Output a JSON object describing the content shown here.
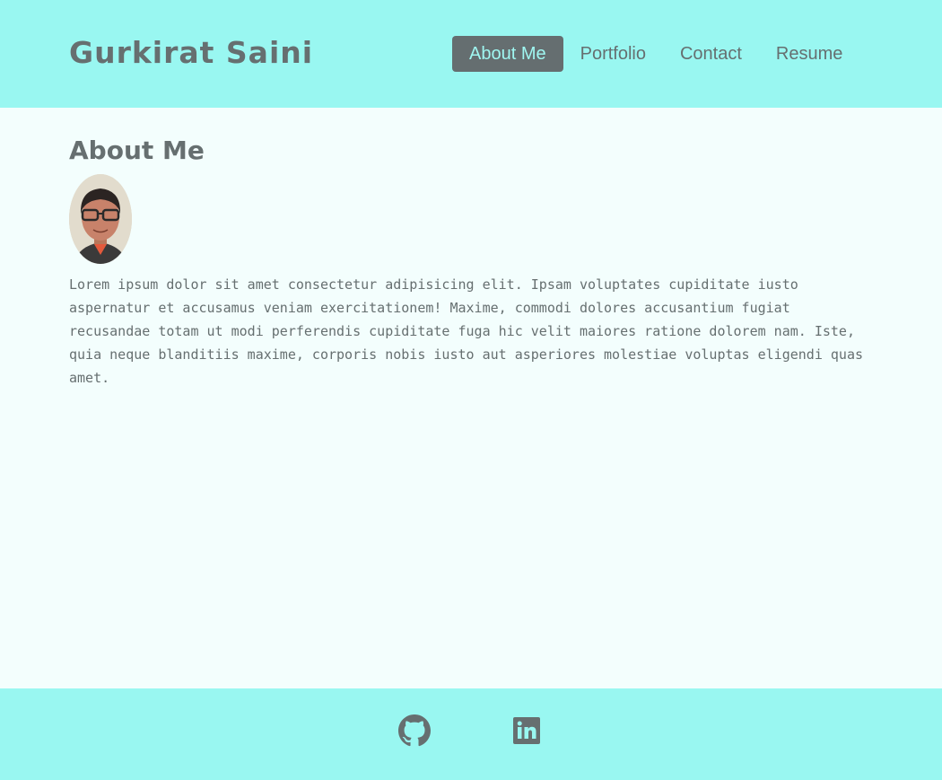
{
  "header": {
    "site_title": "Gurkirat Saini",
    "nav": [
      {
        "label": "About Me",
        "active": true
      },
      {
        "label": "Portfolio",
        "active": false
      },
      {
        "label": "Contact",
        "active": false
      },
      {
        "label": "Resume",
        "active": false
      }
    ]
  },
  "main": {
    "section_title": "About Me",
    "bio": "Lorem ipsum dolor sit amet consectetur adipisicing elit. Ipsam voluptates cupiditate iusto aspernatur et accusamus veniam exercitationem! Maxime, commodi dolores accusantium fugiat recusandae totam ut modi perferendis cupiditate fuga hic velit maiores ratione dolorem nam. Iste, quia neque blanditiis maxime, corporis nobis iusto aut asperiores molestiae voluptas eligendi quas amet."
  },
  "footer": {
    "links": [
      {
        "icon": "github-icon"
      },
      {
        "icon": "linkedin-icon"
      }
    ]
  },
  "colors": {
    "header_bg": "#99f7f1",
    "page_bg": "#f3fefd",
    "text": "#666f70",
    "active_nav_bg": "#656e70",
    "active_nav_text": "#9ff7f1"
  }
}
